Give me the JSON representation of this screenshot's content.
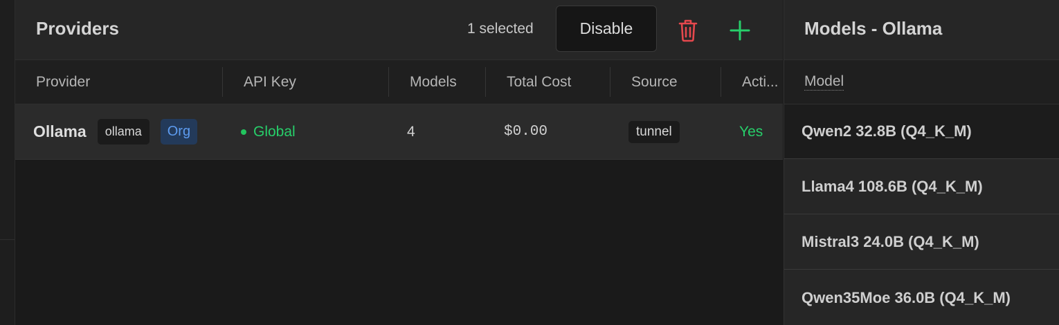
{
  "providers": {
    "title": "Providers",
    "selected_count": "1 selected",
    "disable_label": "Disable",
    "delete_icon": "trash-icon",
    "add_icon": "plus-icon",
    "columns": [
      "Provider",
      "API Key",
      "Models",
      "Total Cost",
      "Source",
      "Acti..."
    ],
    "rows": [
      {
        "name": "Ollama",
        "tag": "ollama",
        "scope": "Org",
        "api_key": "Global",
        "models": "4",
        "total_cost": "$0.00",
        "source": "tunnel",
        "active": "Yes"
      }
    ]
  },
  "models_panel": {
    "title": "Models - Ollama",
    "column": "Model",
    "items": [
      "Qwen2 32.8B (Q4_K_M)",
      "Llama4 108.6B (Q4_K_M)",
      "Mistral3 24.0B (Q4_K_M)",
      "Qwen35Moe 36.0B (Q4_K_M)"
    ]
  },
  "colors": {
    "accent_green": "#27cf6a",
    "delete_red": "#e5484d",
    "org_blue": "#5d9cf0"
  }
}
